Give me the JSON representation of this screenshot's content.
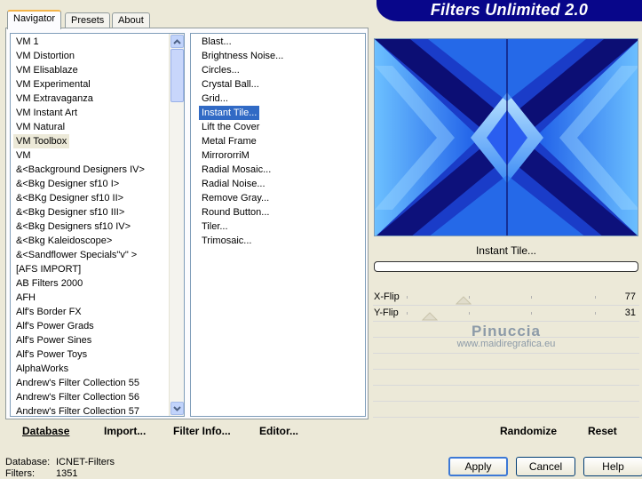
{
  "tabs": [
    "Navigator",
    "Presets",
    "About"
  ],
  "banner_title": "Filters Unlimited 2.0",
  "categories": [
    "VM 1",
    "VM Distortion",
    "VM Elisablaze",
    "VM Experimental",
    "VM Extravaganza",
    "VM Instant Art",
    "VM Natural",
    "VM Toolbox",
    "VM",
    "&<Background Designers IV>",
    "&<Bkg Designer sf10 I>",
    "&<BKg Designer sf10 II>",
    "&<Bkg Designer sf10 III>",
    "&<Bkg Designers sf10 IV>",
    "&<Bkg Kaleidoscope>",
    "&<Sandflower Specials\"v\" >",
    "[AFS IMPORT]",
    "AB Filters 2000",
    "AFH",
    "Alf's Border FX",
    "Alf's Power Grads",
    "Alf's Power Sines",
    "Alf's Power Toys",
    "AlphaWorks",
    "Andrew's Filter Collection 55",
    "Andrew's Filter Collection 56",
    "Andrew's Filter Collection 57"
  ],
  "filters": [
    "Blast...",
    "Brightness Noise...",
    "Circles...",
    "Crystal Ball...",
    "Grid...",
    "Instant Tile...",
    "Lift the Cover",
    "Metal Frame",
    "MirrororriM",
    "Radial Mosaic...",
    "Radial Noise...",
    "Remove Gray...",
    "Round Button...",
    "Tiler...",
    "Trimosaic..."
  ],
  "selected_category": "VM Toolbox",
  "selected_filter": "Instant Tile...",
  "toolbar": {
    "database": "Database",
    "import": "Import...",
    "filter_info": "Filter Info...",
    "editor": "Editor..."
  },
  "preview": {
    "filter_name": "Instant Tile...",
    "progress": 0
  },
  "sliders": [
    {
      "label": "X-Flip",
      "value": 77
    },
    {
      "label": "Y-Flip",
      "value": 31
    }
  ],
  "watermark": {
    "line1": "Pinuccia",
    "line2": "www.maidiregrafica.eu"
  },
  "right_buttons": {
    "randomize": "Randomize",
    "reset": "Reset"
  },
  "status": {
    "database_label": "Database:",
    "database_value": "ICNET-Filters",
    "filters_label": "Filters:",
    "filters_value": "1351"
  },
  "dialog_buttons": {
    "apply": "Apply",
    "cancel": "Cancel",
    "help": "Help"
  },
  "colors": {
    "selection": "#316ac5",
    "banner": "#08068a",
    "preview_dark": "#0c0e74",
    "preview_light": "#5fb3ff"
  }
}
